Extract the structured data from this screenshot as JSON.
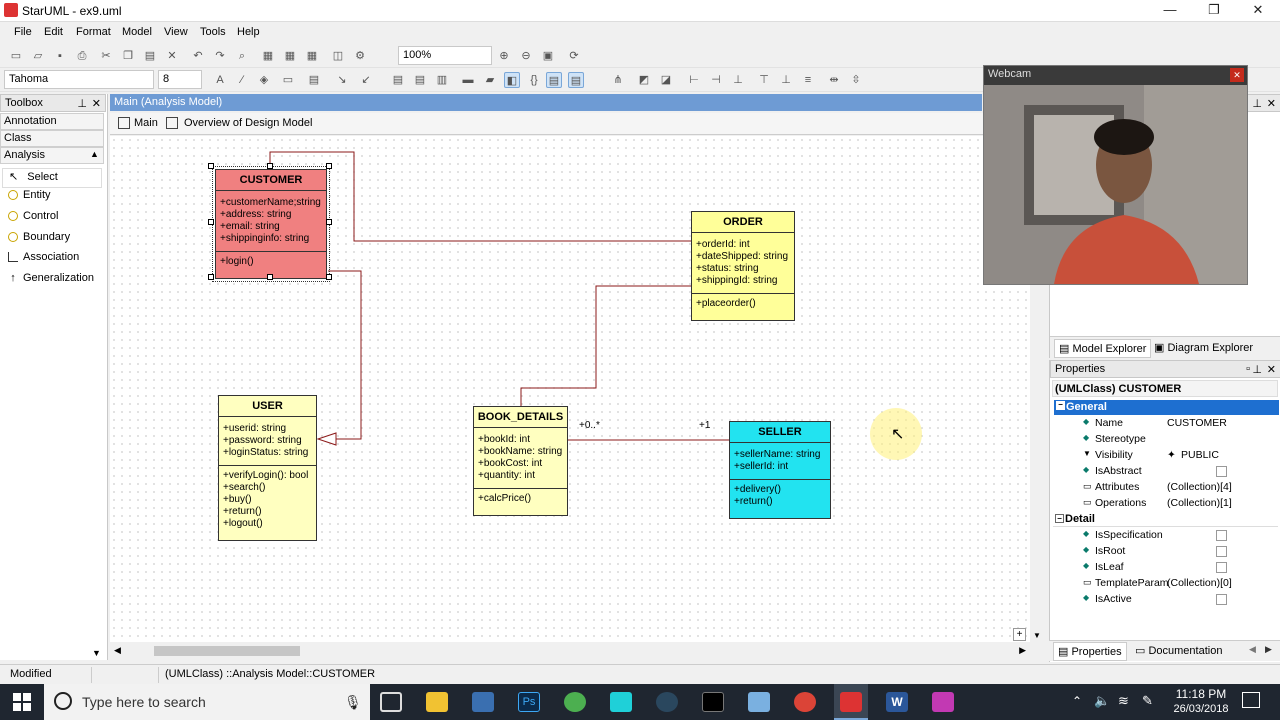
{
  "window": {
    "title": "StarUML - ex9.uml",
    "minimize": "—",
    "maximize": "❐",
    "close": "✕"
  },
  "menu": [
    "File",
    "Edit",
    "Format",
    "Model",
    "View",
    "Tools",
    "Help"
  ],
  "toolbar": {
    "zoom": "100%",
    "font_name": "Tahoma",
    "font_size": "8"
  },
  "toolbox": {
    "title": "Toolbox",
    "categories": [
      "Annotation",
      "Class",
      "Analysis"
    ],
    "items": [
      "Select",
      "Entity",
      "Control",
      "Boundary",
      "Association",
      "Generalization"
    ]
  },
  "doc": {
    "title": "Main (Analysis Model)",
    "tabs": [
      "Main",
      "Overview of Design Model"
    ]
  },
  "classes": {
    "customer": {
      "name": "CUSTOMER",
      "attrs": [
        "+customerName;string",
        "+address: string",
        "+email: string",
        "+shippinginfo: string"
      ],
      "ops": [
        "+login()"
      ]
    },
    "order": {
      "name": "ORDER",
      "attrs": [
        "+orderId: int",
        "+dateShipped: string",
        "+status: string",
        "+shippingId: string"
      ],
      "ops": [
        "+placeorder()"
      ]
    },
    "user": {
      "name": "USER",
      "attrs": [
        "+userid: string",
        "+password: string",
        "+loginStatus: string"
      ],
      "ops": [
        "+verifyLogin(): bool",
        "+search()",
        "+buy()",
        "+return()",
        "+logout()"
      ]
    },
    "book": {
      "name": "BOOK_DETAILS",
      "attrs": [
        "+bookId: int",
        "+bookName: string",
        "+bookCost: int",
        "+quantity: int"
      ],
      "ops": [
        "+calcPrice()"
      ]
    },
    "seller": {
      "name": "SELLER",
      "attrs": [
        "+sellerName: string",
        "+sellerId: int"
      ],
      "ops": [
        "+delivery()",
        "+return()"
      ]
    }
  },
  "assoc_labels": {
    "book_end": "+0..*",
    "seller_end": "+1"
  },
  "colors": {
    "customer": "#f08080",
    "order": "#ffff99",
    "user": "#ffffc0",
    "book": "#ffffc0",
    "seller": "#22e3f0",
    "link": "#8b1a1a"
  },
  "webcam": {
    "title": "Webcam",
    "close": "✕"
  },
  "explorer_tabs": [
    "Model Explorer",
    "Diagram Explorer"
  ],
  "properties": {
    "title": "Properties",
    "object": "(UMLClass) CUSTOMER",
    "general": "General",
    "detail": "Detail",
    "rows_general": [
      {
        "name": "Name",
        "value": "CUSTOMER"
      },
      {
        "name": "Stereotype",
        "value": ""
      },
      {
        "name": "Visibility",
        "value": "PUBLIC"
      },
      {
        "name": "IsAbstract",
        "value": ""
      },
      {
        "name": "Attributes",
        "value": "(Collection)[4]"
      },
      {
        "name": "Operations",
        "value": "(Collection)[1]"
      }
    ],
    "rows_detail": [
      {
        "name": "IsSpecification",
        "value": ""
      },
      {
        "name": "IsRoot",
        "value": ""
      },
      {
        "name": "IsLeaf",
        "value": ""
      },
      {
        "name": "TemplateParam",
        "value": "(Collection)[0]"
      },
      {
        "name": "IsActive",
        "value": ""
      }
    ],
    "bottom_tabs": [
      "Properties",
      "Documentation"
    ]
  },
  "status": {
    "state": "Modified",
    "path": "(UMLClass) ::Analysis Model::CUSTOMER"
  },
  "taskbar": {
    "search_placeholder": "Type here to search",
    "time": "11:18 PM",
    "date": "26/03/2018"
  }
}
